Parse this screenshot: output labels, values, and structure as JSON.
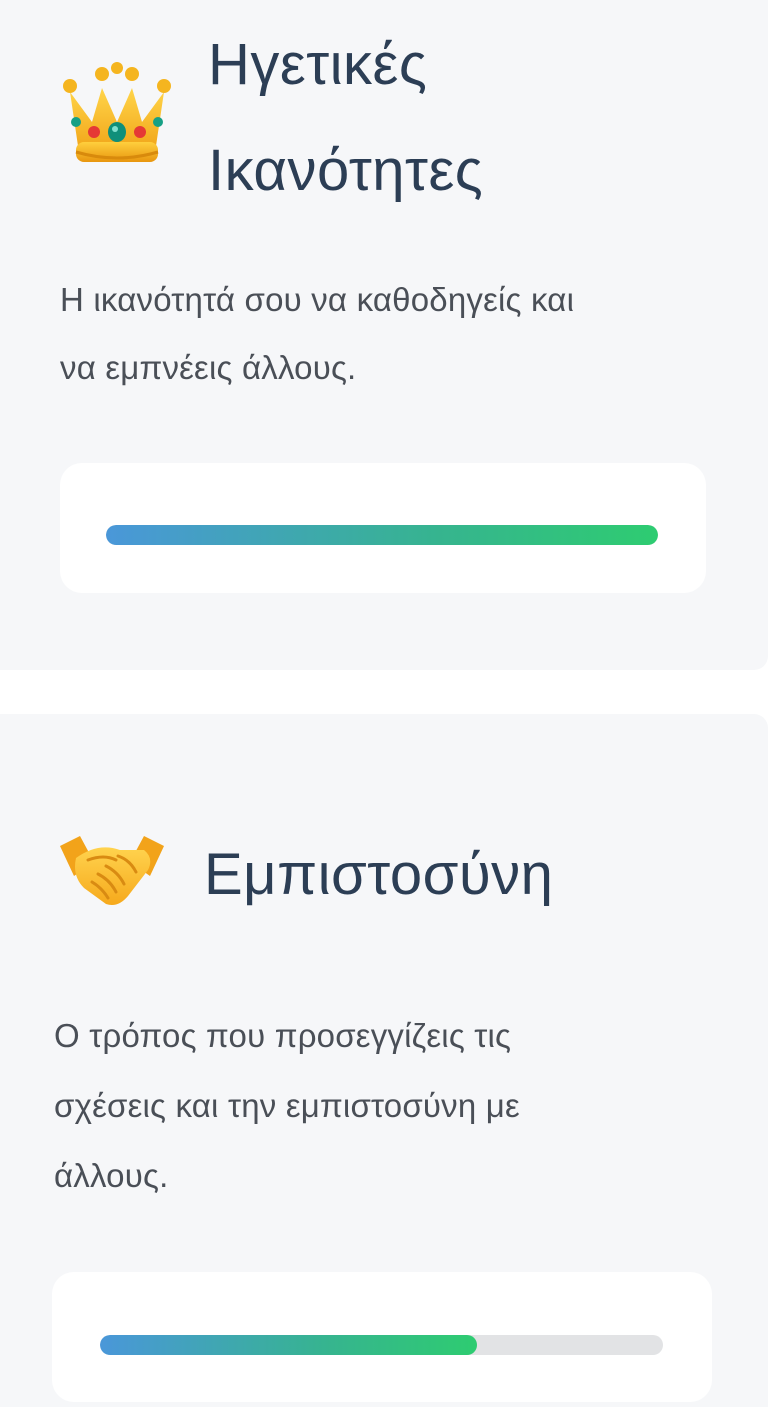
{
  "sections": [
    {
      "icon": "crown-icon",
      "title_line1": "Ηγετικές",
      "title_line2": "Ικανότητες",
      "description_line1": "Η ικανότητά σου να καθοδηγείς και",
      "description_line2": "να εμπνέεις άλλους.",
      "progress": 1.0
    },
    {
      "icon": "handshake-icon",
      "title": "Εμπιστοσύνη",
      "description_line1": "Ο τρόπος που προσεγγίζεις τις",
      "description_line2": "σχέσεις και την εμπιστοσύνη με",
      "description_line3": "άλλους.",
      "progress": 0.67
    }
  ],
  "colors": {
    "card_background": "#f6f7f9",
    "title": "#2c3e55",
    "description": "#4a4f57",
    "progress_start": "#4a97d9",
    "progress_end": "#2ecc71",
    "progress_track": "#e2e3e5"
  }
}
